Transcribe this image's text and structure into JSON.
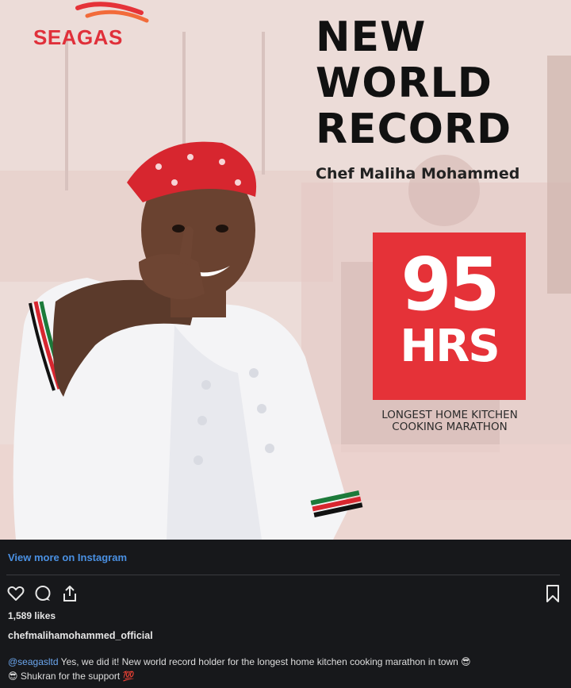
{
  "post": {
    "brand": "SEAGAS",
    "headline": [
      "NEW",
      "WORLD",
      "RECORD"
    ],
    "chef_name": "Chef Maliha Mohammed",
    "record_number": "95",
    "record_unit": "HRS",
    "record_caption": [
      "LONGEST HOME KITCHEN",
      "COOKING MARATHON"
    ]
  },
  "panel": {
    "view_more": "View more on Instagram",
    "likes": "1,589 likes",
    "username": "chefmalihamohammed_official",
    "caption_mention": "@seagasltd",
    "caption_text": " Yes, we did it! New world record holder for the longest home kitchen cooking marathon in town ",
    "caption_emoji_1": "😎",
    "caption_line2_emoji": "😎",
    "caption_line2": " Shukran for the support ",
    "caption_emoji_2": "💯"
  },
  "icons": [
    "heart-icon",
    "comment-icon",
    "share-icon",
    "bookmark-icon"
  ],
  "colors": {
    "brand_red": "#e53238",
    "link_blue": "#4a90e2",
    "panel_bg": "#17181b"
  }
}
